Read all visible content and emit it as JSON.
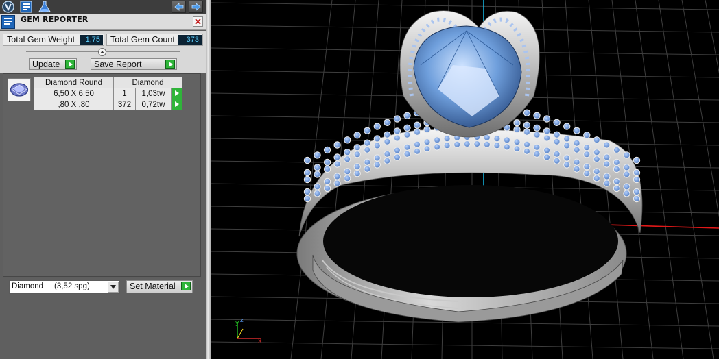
{
  "app": {
    "panel_title": "GEM REPORTER",
    "toolbar_icons": [
      "app-logo-icon",
      "gem-report-icon",
      "render-flask-icon"
    ],
    "nav_icons": [
      "arrow-left-icon",
      "arrow-right-icon"
    ]
  },
  "stats": {
    "total_weight_label": "Total Gem Weight",
    "total_weight_value": "1,75",
    "total_count_label": "Total Gem Count",
    "total_count_value": "373"
  },
  "actions": {
    "update_label": "Update",
    "save_report_label": "Save Report"
  },
  "gem_table": {
    "headers": [
      "Diamond Round",
      "Diamond"
    ],
    "rows": [
      {
        "size": "6,50 X 6,50",
        "count": "1",
        "weight": "1,03tw"
      },
      {
        "size": ",80 X ,80",
        "count": "372",
        "weight": "0,72tw"
      }
    ]
  },
  "material": {
    "name": "Diamond",
    "spg": "(3,52 spg)",
    "set_label": "Set Material"
  },
  "viewport": {
    "axis_labels": [
      "z",
      "y",
      "x"
    ],
    "colors": {
      "grid": "#3e3e3e",
      "x_axis": "#ff2020",
      "y_axis": "#18d0ff",
      "metal": "#c8c8c8",
      "gem": "#6f9fdc"
    }
  }
}
